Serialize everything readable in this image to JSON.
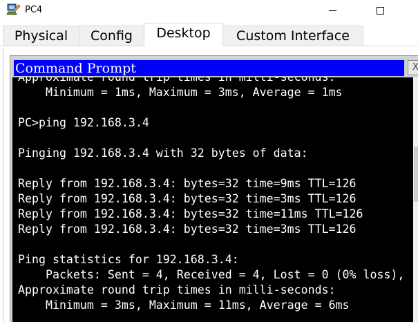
{
  "window": {
    "title": "PC4",
    "icon": "pc-app-icon",
    "controls": [
      "minimize-icon",
      "maximize-icon"
    ]
  },
  "tabs": [
    {
      "label": "Physical",
      "active": false
    },
    {
      "label": "Config",
      "active": false
    },
    {
      "label": "Desktop",
      "active": true
    },
    {
      "label": "Custom Interface",
      "active": false
    }
  ],
  "command_prompt": {
    "title": "Command Prompt",
    "close_label": "X",
    "lines": [
      "Approximate round trip times in milli-seconds:",
      "    Minimum = 1ms, Maximum = 3ms, Average = 1ms",
      "",
      "PC>ping 192.168.3.4",
      "",
      "Pinging 192.168.3.4 with 32 bytes of data:",
      "",
      "Reply from 192.168.3.4: bytes=32 time=9ms TTL=126",
      "Reply from 192.168.3.4: bytes=32 time=3ms TTL=126",
      "Reply from 192.168.3.4: bytes=32 time=11ms TTL=126",
      "Reply from 192.168.3.4: bytes=32 time=3ms TTL=126",
      "",
      "Ping statistics for 192.168.3.4:",
      "    Packets: Sent = 4, Received = 4, Lost = 0 (0% loss),",
      "Approximate round trip times in milli-seconds:",
      "    Minimum = 3ms, Maximum = 11ms, Average = 6ms"
    ]
  },
  "colors": {
    "cmd_title_bg": "#0000ff",
    "terminal_bg": "#000000",
    "terminal_fg": "#ffffff"
  }
}
